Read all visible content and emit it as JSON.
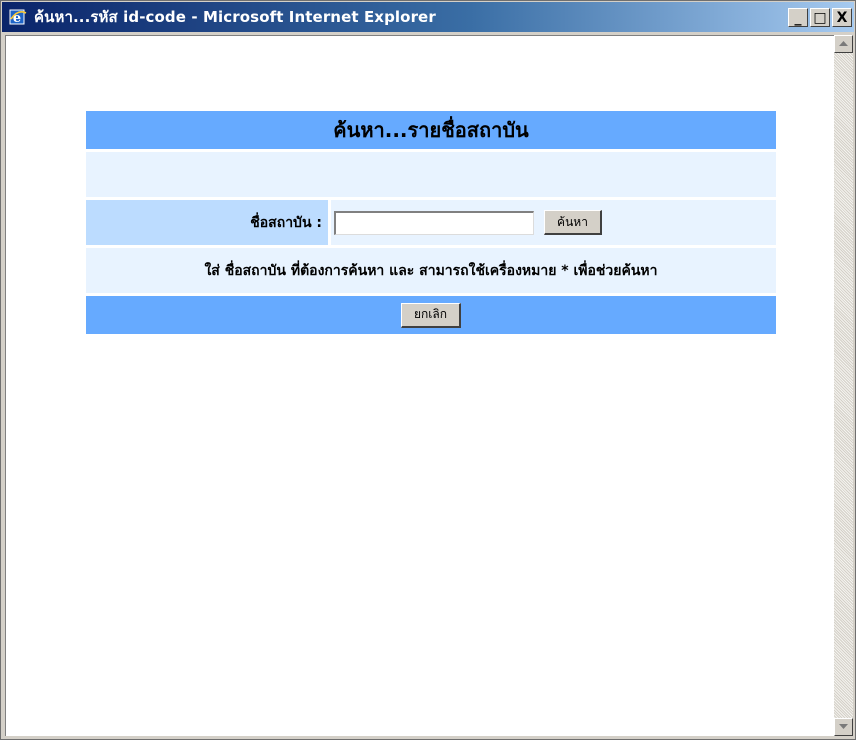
{
  "window": {
    "title": "ค้นหา...รหัส id-code - Microsoft Internet Explorer",
    "icon": "ie-icon",
    "controls": {
      "minimize": "_",
      "maximize": "□",
      "close": "X"
    }
  },
  "form": {
    "header": "ค้นหา...รายชื่อสถาบัน",
    "field_label": "ชื่อสถาบัน :",
    "input_value": "",
    "search_button": "ค้นหา",
    "hint": "ใส่ ชื่อสถาบัน ที่ต้องการค้นหา และ สามารถใช้เครื่องหมาย * เพื่อช่วยค้นหา",
    "cancel_button": "ยกเลิก"
  },
  "colors": {
    "header_bg": "#66aaff",
    "label_bg": "#bcdcff",
    "light_bg": "#e8f3ff"
  }
}
